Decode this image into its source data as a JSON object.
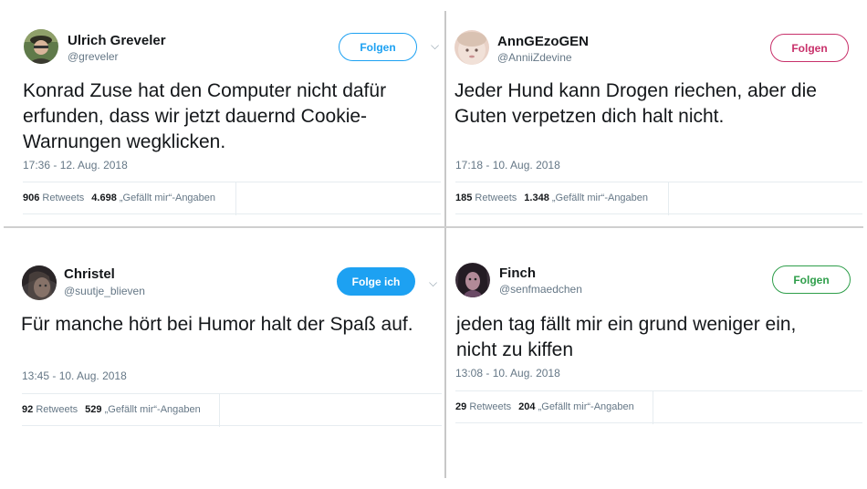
{
  "tweets": [
    {
      "name": "Ulrich Greveler",
      "handle": "@greveler",
      "follow_label": "Folgen",
      "text_lines": [
        "Konrad Zuse hat den Computer nicht dafür",
        "erfunden, dass wir jetzt dauernd Cookie-",
        "Warnungen wegklicken."
      ],
      "timestamp": "17:36 - 12. Aug. 2018",
      "retweets": "906",
      "retweets_label": "Retweets",
      "likes": "4.698",
      "likes_label": "„Gefällt mir“-Angaben"
    },
    {
      "name": "AnnGEzoGEN",
      "handle": "@AnniiZdevine",
      "follow_label": "Folgen",
      "text_lines": [
        "Jeder Hund kann Drogen riechen, aber die",
        "Guten verpetzen dich halt nicht."
      ],
      "timestamp": "17:18 - 10. Aug. 2018",
      "retweets": "185",
      "retweets_label": "Retweets",
      "likes": "1.348",
      "likes_label": "„Gefällt mir“-Angaben"
    },
    {
      "name": "Christel",
      "handle": "@suutje_blieven",
      "follow_label": "Folge ich",
      "text_lines": [
        "Für manche hört bei Humor halt der Spaß auf."
      ],
      "timestamp": "13:45 - 10. Aug. 2018",
      "retweets": "92",
      "retweets_label": "Retweets",
      "likes": "529",
      "likes_label": "„Gefällt mir“-Angaben"
    },
    {
      "name": "Finch",
      "handle": "@senfmaedchen",
      "follow_label": "Folgen",
      "text_lines": [
        "jeden tag fällt mir ein grund weniger ein,",
        "nicht zu kiffen"
      ],
      "timestamp": "13:08 - 10. Aug. 2018",
      "retweets": "29",
      "retweets_label": "Retweets",
      "likes": "204",
      "likes_label": "„Gefällt mir“-Angaben"
    }
  ],
  "colors": {
    "twitter_blue": "#1da1f2",
    "pink_accent": "#c8306a",
    "green_accent": "#2e9e4a"
  },
  "icons": [
    "avatar-photo",
    "chevron-down-icon"
  ]
}
